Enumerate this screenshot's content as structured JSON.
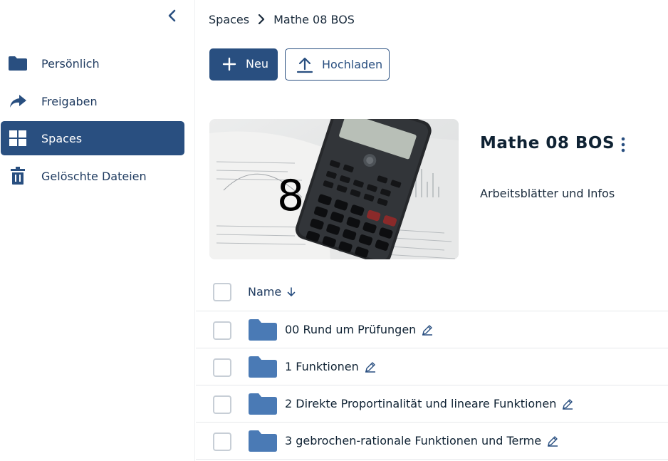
{
  "sidebar": {
    "collapse_icon": "chevron-left-icon",
    "items": [
      {
        "label": "Persönlich",
        "icon": "folder-icon"
      },
      {
        "label": "Freigaben",
        "icon": "share-icon"
      },
      {
        "label": "Spaces",
        "icon": "grid-icon",
        "active": true
      },
      {
        "label": "Gelöschte Dateien",
        "icon": "trash-icon"
      }
    ]
  },
  "breadcrumb": {
    "items": [
      "Spaces",
      "Mathe 08 BOS"
    ]
  },
  "toolbar": {
    "new_label": "Neu",
    "upload_label": "Hochladen"
  },
  "space": {
    "image_number": "8",
    "title": "Mathe 08 BOS",
    "description": "Arbeitsblätter und Infos"
  },
  "table": {
    "column_name": "Name",
    "rows": [
      {
        "name": "00 Rund um Prüfungen"
      },
      {
        "name": "1 Funktionen"
      },
      {
        "name": "2 Direkte Proportinalität und lineare Funktionen"
      },
      {
        "name": "3 gebrochen-rationale Funktionen und Terme"
      }
    ]
  },
  "colors": {
    "primary": "#294f80",
    "folder": "#4a7ab5",
    "text": "#0f2233"
  }
}
